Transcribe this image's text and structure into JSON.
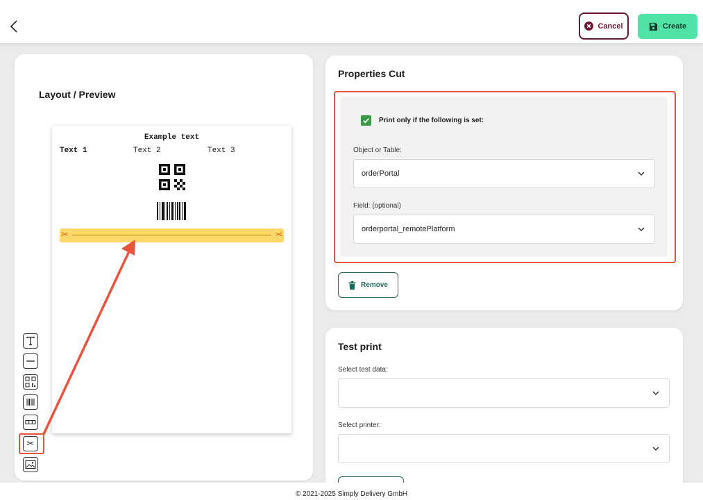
{
  "header": {
    "back_icon": "chevron-left-icon",
    "cancel_label": "Cancel",
    "cancel_icon": "x-circle-icon",
    "create_label": "Create",
    "create_icon": "floppy-disk-icon",
    "colors": {
      "cancel": "#6b1530",
      "create_bg": "#4fe3a6"
    }
  },
  "layout": {
    "title": "Layout / Preview",
    "preview": {
      "heading": "Example text",
      "columns": [
        "Text 1",
        "Text 2",
        "Text 3"
      ],
      "elements": [
        "qr-code-icon",
        "barcode-icon",
        "cut-line"
      ]
    },
    "tools": [
      {
        "name": "text-tool",
        "icon": "text-t-icon"
      },
      {
        "name": "line-tool",
        "icon": "horizontal-line-icon"
      },
      {
        "name": "qr-tool",
        "icon": "qr-code-icon"
      },
      {
        "name": "barcode-tool",
        "icon": "barcode-icon"
      },
      {
        "name": "table-tool",
        "icon": "table-row-icon"
      },
      {
        "name": "cut-tool",
        "icon": "scissors-icon",
        "highlighted": true
      },
      {
        "name": "image-tool",
        "icon": "image-icon"
      }
    ]
  },
  "properties": {
    "title": "Properties Cut",
    "checkbox_label": "Print only if the following is set:",
    "checkbox_checked": true,
    "object_label": "Object or Table:",
    "object_value": "orderPortal",
    "field_label": "Field: (optional)",
    "field_value": "orderportal_remotePlatform",
    "remove_label": "Remove",
    "remove_icon": "trash-icon"
  },
  "test_print": {
    "title": "Test print",
    "data_label": "Select test data:",
    "data_value": "",
    "printer_label": "Select printer:",
    "printer_value": ""
  },
  "footer": {
    "text": "© 2021-2025 Simply Delivery GmbH"
  },
  "annotation": {
    "color": "#e8553b"
  }
}
